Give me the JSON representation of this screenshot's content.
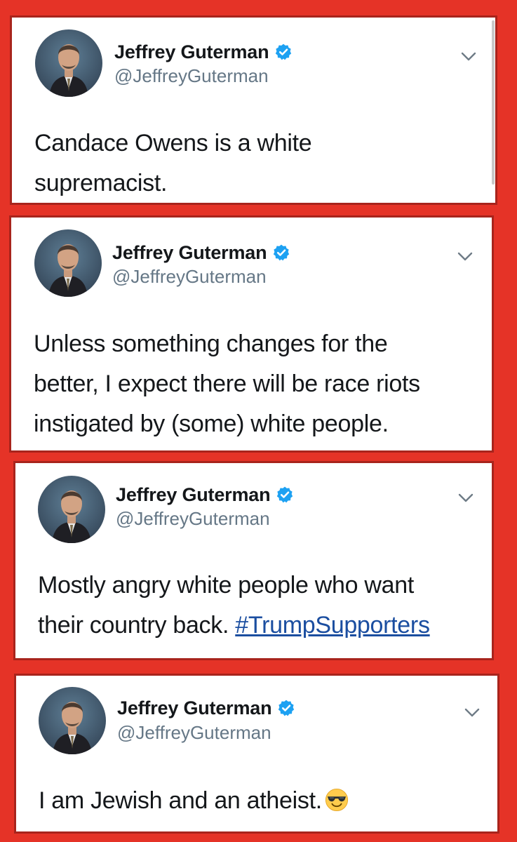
{
  "colors": {
    "background": "#e53327",
    "card": "#ffffff",
    "name": "#14171a",
    "handle": "#657786",
    "verified": "#1da1f2",
    "hashtag": "#1b4ea0"
  },
  "tweets": [
    {
      "author": {
        "name": "Jeffrey Guterman",
        "handle": "@JeffreyGuterman",
        "verified_icon": "verified-badge-icon"
      },
      "lines": [
        "Candace Owens is a white",
        "supremacist."
      ]
    },
    {
      "author": {
        "name": "Jeffrey Guterman",
        "handle": "@JeffreyGuterman",
        "verified_icon": "verified-badge-icon"
      },
      "lines": [
        "Unless something changes for the",
        "better, I expect there will be race riots",
        "instigated by (some) white people."
      ]
    },
    {
      "author": {
        "name": "Jeffrey Guterman",
        "handle": "@JeffreyGuterman",
        "verified_icon": "verified-badge-icon"
      },
      "lines": [
        "Mostly angry white people who want",
        "their country back. "
      ],
      "hashtag": "#TrumpSupporters"
    },
    {
      "author": {
        "name": "Jeffrey Guterman",
        "handle": "@JeffreyGuterman",
        "verified_icon": "verified-badge-icon"
      },
      "lines": [
        "I am Jewish and an atheist."
      ],
      "emoji": "smiling-face-with-sunglasses"
    }
  ]
}
